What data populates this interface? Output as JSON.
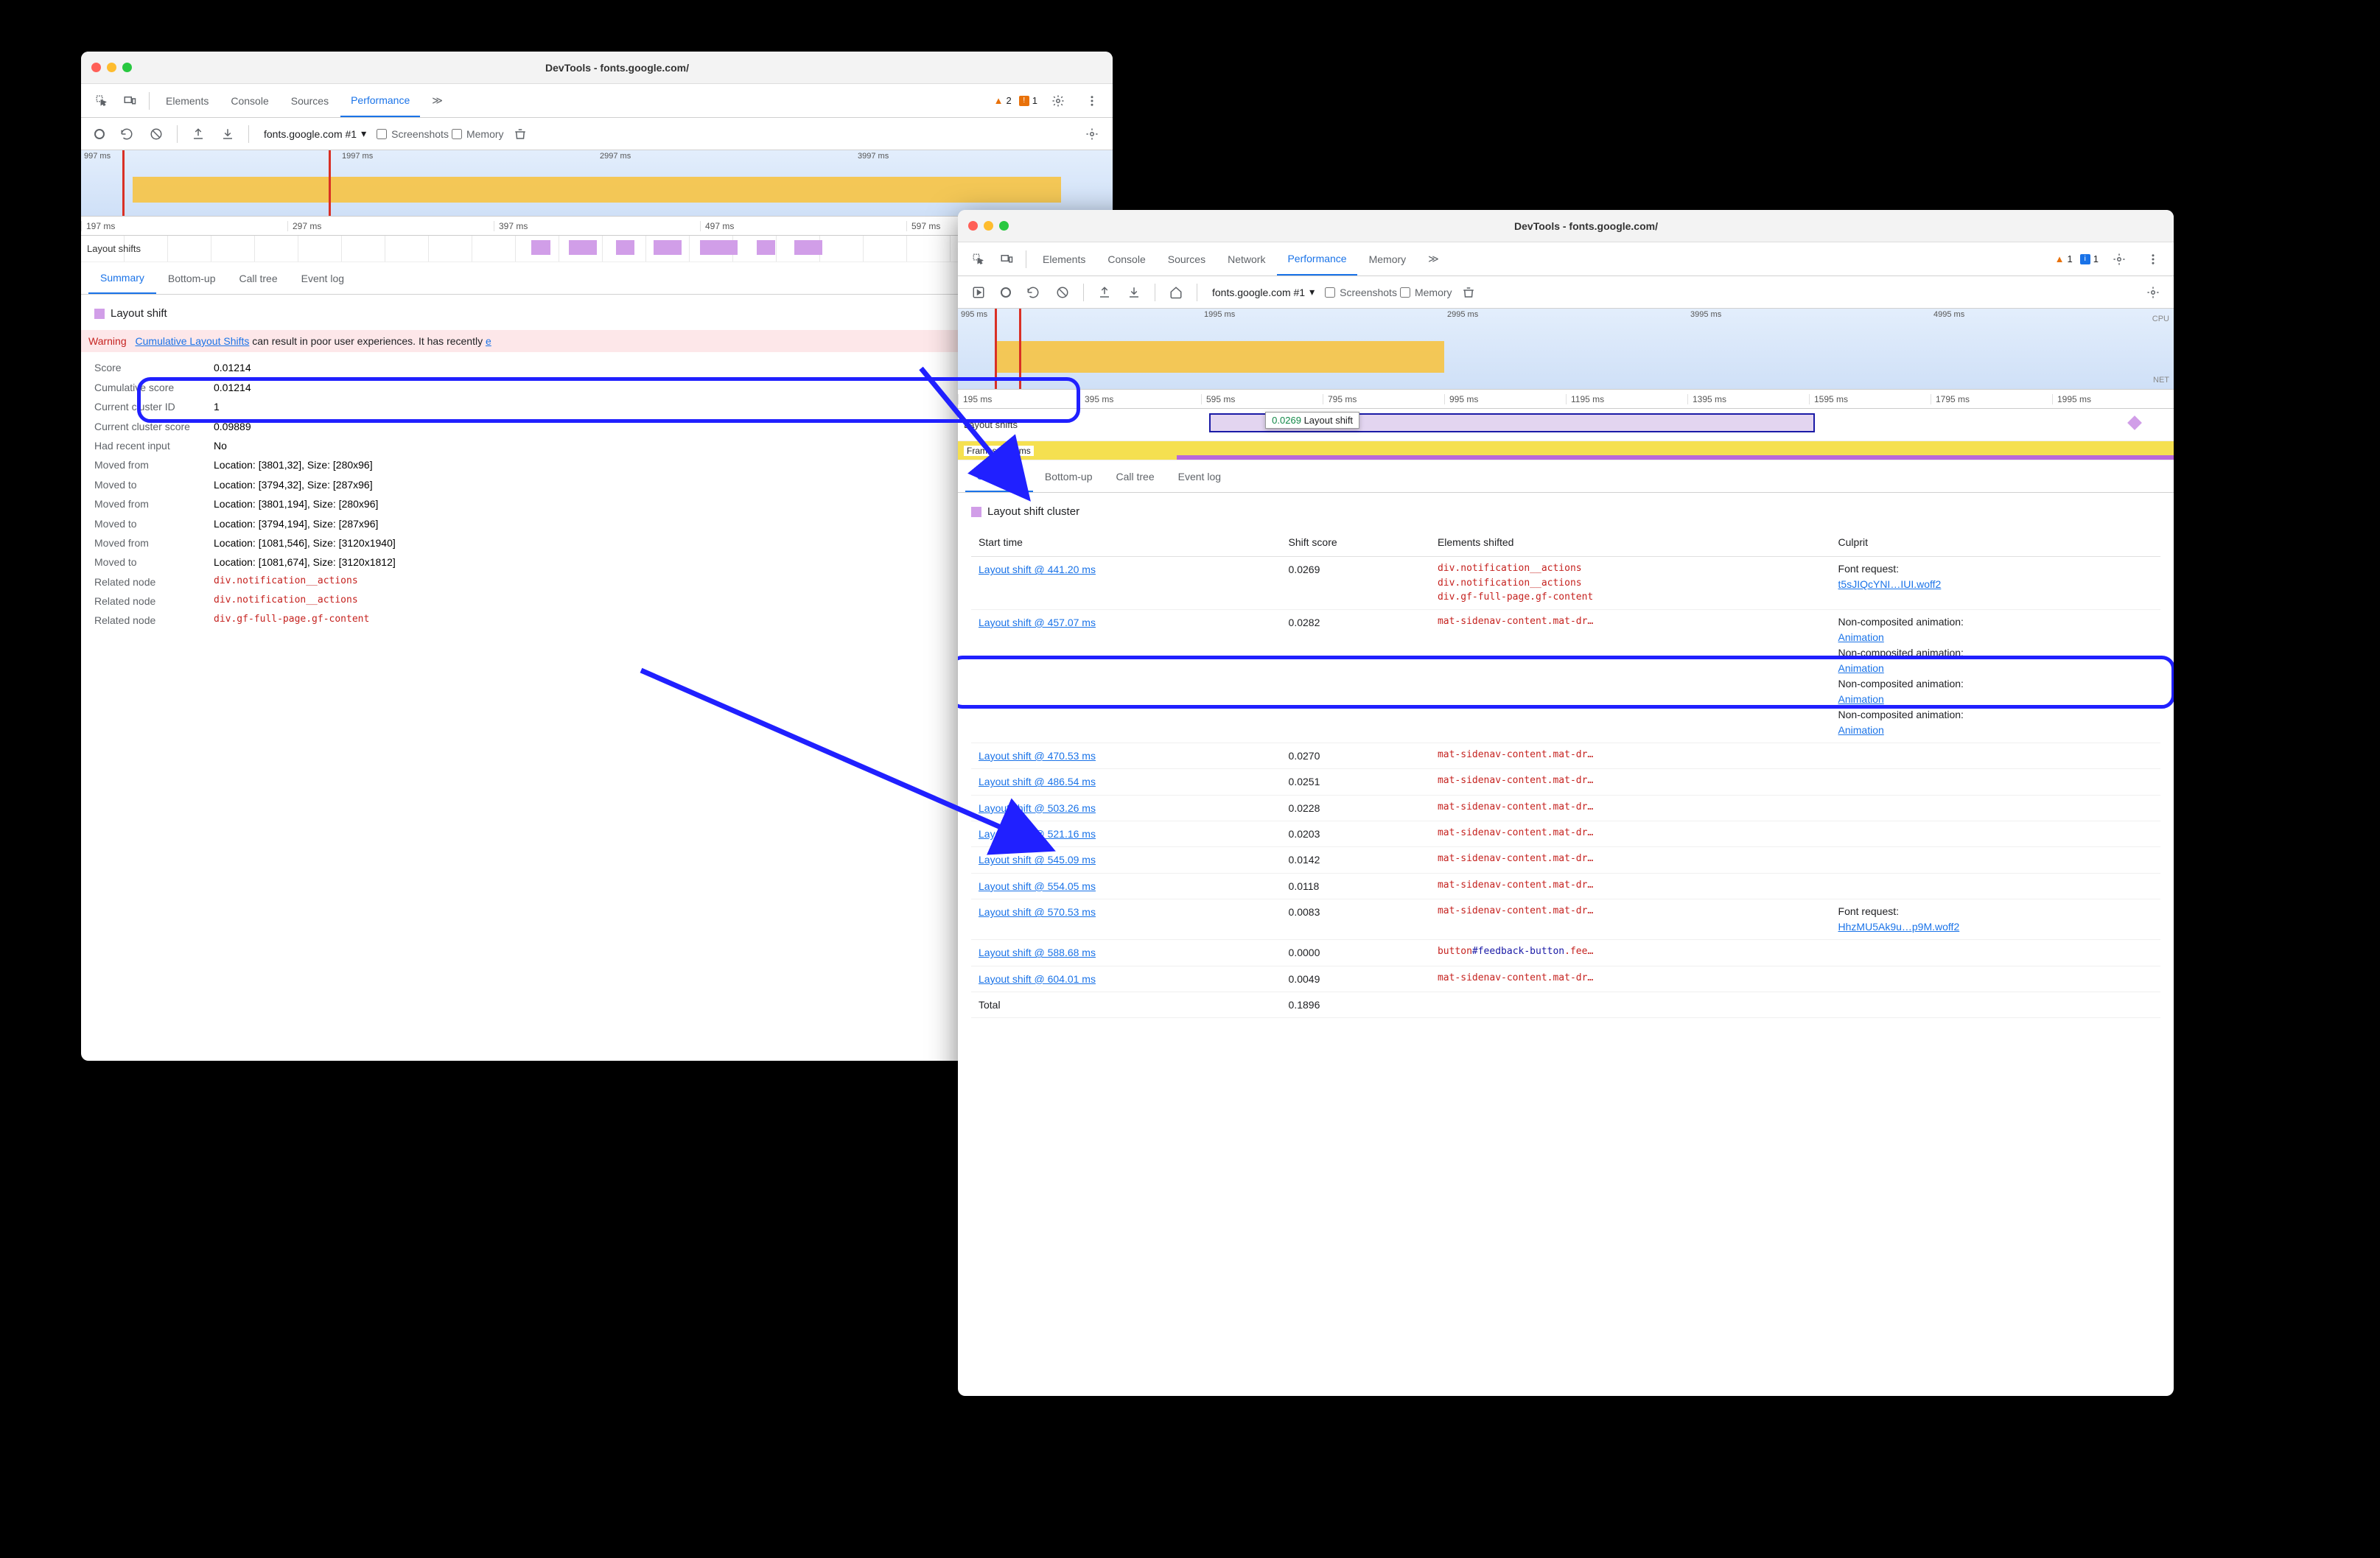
{
  "win1": {
    "title": "DevTools - fonts.google.com/",
    "tabs": [
      "Elements",
      "Console",
      "Sources",
      "Performance"
    ],
    "active_tab": "Performance",
    "more_glyph": "≫",
    "warn_count": "2",
    "issue_count": "1",
    "url_sel": "fonts.google.com #1",
    "cb_screenshots": "Screenshots",
    "cb_memory": "Memory",
    "overview_ticks": [
      "997 ms",
      "1997 ms",
      "2997 ms",
      "3997 ms"
    ],
    "ruler": [
      "197 ms",
      "297 ms",
      "397 ms",
      "497 ms",
      "597 ms"
    ],
    "track_label": "Layout shifts",
    "subtabs": [
      "Summary",
      "Bottom-up",
      "Call tree",
      "Event log"
    ],
    "active_subtab": "Summary",
    "heading": "Layout shift",
    "warn_label": "Warning",
    "warn_link": "Cumulative Layout Shifts",
    "warn_rest": " can result in poor user experiences. It has recently ",
    "rows": [
      {
        "k": "Score",
        "v": "0.01214"
      },
      {
        "k": "Cumulative score",
        "v": "0.01214"
      },
      {
        "k": "Current cluster ID",
        "v": "1"
      },
      {
        "k": "Current cluster score",
        "v": "0.09889"
      },
      {
        "k": "Had recent input",
        "v": "No"
      },
      {
        "k": "Moved from",
        "v": "Location: [3801,32], Size: [280x96]"
      },
      {
        "k": "Moved to",
        "v": "Location: [3794,32], Size: [287x96]"
      },
      {
        "k": "Moved from",
        "v": "Location: [3801,194], Size: [280x96]"
      },
      {
        "k": "Moved to",
        "v": "Location: [3794,194], Size: [287x96]"
      },
      {
        "k": "Moved from",
        "v": "Location: [1081,546], Size: [3120x1940]"
      },
      {
        "k": "Moved to",
        "v": "Location: [1081,674], Size: [3120x1812]"
      }
    ],
    "related": [
      {
        "k": "Related node",
        "v": "div.notification__actions"
      },
      {
        "k": "Related node",
        "v": "div.notification__actions"
      },
      {
        "k": "Related node",
        "v": "div.gf-full-page.gf-content"
      }
    ]
  },
  "win2": {
    "title": "DevTools - fonts.google.com/",
    "tabs": [
      "Elements",
      "Console",
      "Sources",
      "Network",
      "Performance",
      "Memory"
    ],
    "active_tab": "Performance",
    "more_glyph": "≫",
    "warn_count": "1",
    "info_count": "1",
    "url_sel": "fonts.google.com #1",
    "cb_screenshots": "Screenshots",
    "cb_memory": "Memory",
    "cpu_label": "CPU",
    "net_label": "NET",
    "overview_ticks": [
      "995 ms",
      "1995 ms",
      "2995 ms",
      "3995 ms",
      "4995 ms"
    ],
    "ruler": [
      "195 ms",
      "395 ms",
      "595 ms",
      "795 ms",
      "995 ms",
      "1195 ms",
      "1395 ms",
      "1595 ms",
      "1795 ms",
      "1995 ms"
    ],
    "track_label": "Layout shifts",
    "tooltip_score": "0.0269",
    "tooltip_text": "Layout shift",
    "frames_label": "Frames 67.1 ms",
    "subtabs": [
      "Summary",
      "Bottom-up",
      "Call tree",
      "Event log"
    ],
    "active_subtab": "Summary",
    "heading": "Layout shift cluster",
    "th": [
      "Start time",
      "Shift score",
      "Elements shifted",
      "Culprit"
    ],
    "rows": [
      {
        "time": "Layout shift @ 441.20 ms",
        "score": "0.0269",
        "els": [
          "div.notification__actions",
          "div.notification__actions",
          "div.gf-full-page.gf-content"
        ],
        "culprit_lines": [
          {
            "label": "Font request:",
            "link": "t5sJIQcYNI…IUI.woff2"
          }
        ]
      },
      {
        "time": "Layout shift @ 457.07 ms",
        "score": "0.0282",
        "els": [
          "mat-sidenav-content.mat-dr…"
        ],
        "culprit_lines": [
          {
            "label": "Non-composited animation:",
            "link": "Animation"
          },
          {
            "label": "Non-composited animation:",
            "link": "Animation"
          },
          {
            "label": "Non-composited animation:",
            "link": "Animation"
          },
          {
            "label": "Non-composited animation:",
            "link": "Animation"
          }
        ]
      },
      {
        "time": "Layout shift @ 470.53 ms",
        "score": "0.0270",
        "els": [
          "mat-sidenav-content.mat-dr…"
        ],
        "culprit_lines": []
      },
      {
        "time": "Layout shift @ 486.54 ms",
        "score": "0.0251",
        "els": [
          "mat-sidenav-content.mat-dr…"
        ],
        "culprit_lines": []
      },
      {
        "time": "Layout shift @ 503.26 ms",
        "score": "0.0228",
        "els": [
          "mat-sidenav-content.mat-dr…"
        ],
        "culprit_lines": []
      },
      {
        "time": "Layout shift @ 521.16 ms",
        "score": "0.0203",
        "els": [
          "mat-sidenav-content.mat-dr…"
        ],
        "culprit_lines": []
      },
      {
        "time": "Layout shift @ 545.09 ms",
        "score": "0.0142",
        "els": [
          "mat-sidenav-content.mat-dr…"
        ],
        "culprit_lines": []
      },
      {
        "time": "Layout shift @ 554.05 ms",
        "score": "0.0118",
        "els": [
          "mat-sidenav-content.mat-dr…"
        ],
        "culprit_lines": []
      },
      {
        "time": "Layout shift @ 570.53 ms",
        "score": "0.0083",
        "els": [
          "mat-sidenav-content.mat-dr…"
        ],
        "culprit_lines": [
          {
            "label": "Font request:",
            "link": "HhzMU5Ak9u…p9M.woff2"
          }
        ]
      },
      {
        "time": "Layout shift @ 588.68 ms",
        "score": "0.0000",
        "els": [
          "button#feedback-button.fee…"
        ],
        "culprit_lines": []
      },
      {
        "time": "Layout shift @ 604.01 ms",
        "score": "0.0049",
        "els": [
          "mat-sidenav-content.mat-dr…"
        ],
        "culprit_lines": []
      }
    ],
    "total_label": "Total",
    "total_val": "0.1896"
  }
}
